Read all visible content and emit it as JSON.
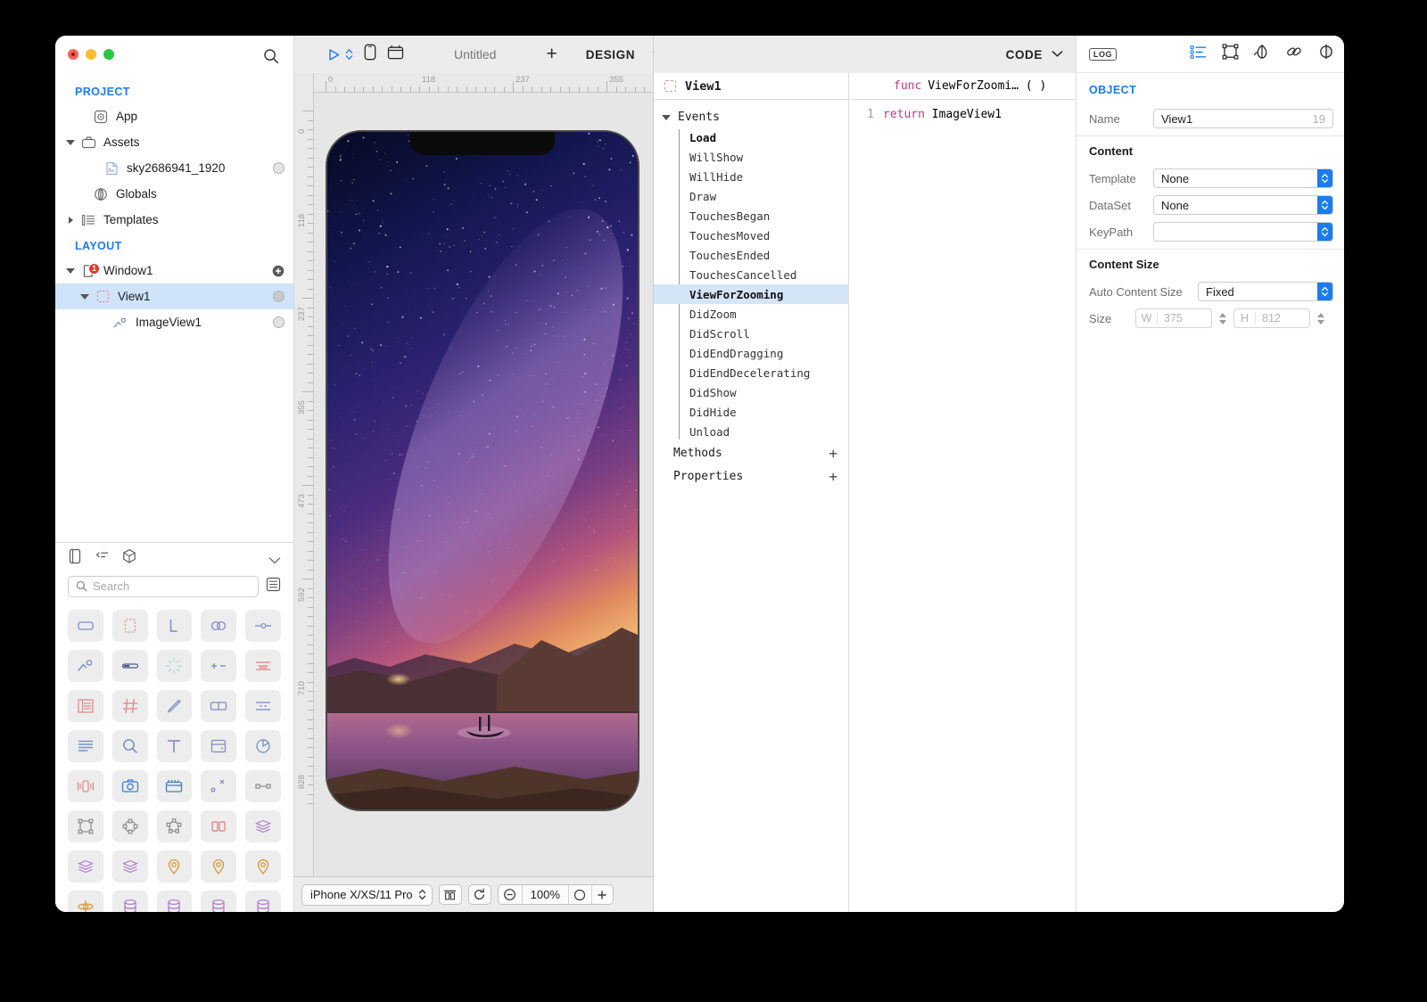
{
  "window": {
    "traffic_lights": [
      "close",
      "minimize",
      "zoom"
    ],
    "search_icon": "search-icon"
  },
  "sidebar": {
    "sections": [
      {
        "label": "PROJECT",
        "items": [
          {
            "label": "App",
            "icon": "app-icon",
            "indent": 1,
            "twisty": "none",
            "dot": false
          },
          {
            "label": "Assets",
            "icon": "assets-briefcase-icon",
            "indent": 1,
            "twisty": "open",
            "dot": false
          },
          {
            "label": "sky2686941_1920",
            "icon": "image-file-icon",
            "indent": 2,
            "twisty": "none",
            "dot": true
          },
          {
            "label": "Globals",
            "icon": "globals-icon",
            "indent": 1,
            "twisty": "none",
            "dot": false
          },
          {
            "label": "Templates",
            "icon": "templates-icon",
            "indent": 1,
            "twisty": "closed",
            "dot": false
          }
        ]
      },
      {
        "label": "LAYOUT",
        "items": [
          {
            "label": "Window1",
            "icon": "window-icon",
            "indent": 1,
            "twisty": "open",
            "dot": false,
            "plus": true,
            "badge": "1"
          },
          {
            "label": "View1",
            "icon": "view-dashed-icon",
            "indent": 2,
            "twisty": "open",
            "dot": true,
            "selected": true
          },
          {
            "label": "ImageView1",
            "icon": "imageview-icon",
            "indent": 3,
            "twisty": "none",
            "dot": true
          }
        ]
      }
    ],
    "palette": {
      "tabs": [
        "library-panel-icon",
        "inspector-list-icon",
        "objects-3d-icon"
      ],
      "collapse_icon": "chevron-down-icon",
      "search_placeholder": "Search",
      "list_mode_icon": "list-view-icon",
      "items": [
        {
          "name": "rounded-rect-icon",
          "color": "#7b8fc7"
        },
        {
          "name": "dashed-box-icon",
          "color": "#e08c8c"
        },
        {
          "name": "layout-L-icon",
          "color": "#7b8fc7"
        },
        {
          "name": "toggle-icon",
          "color": "#7b8fc7"
        },
        {
          "name": "slider-icon",
          "color": "#7b8fc7"
        },
        {
          "name": "imageview-icon",
          "color": "#7b8fc7"
        },
        {
          "name": "progress-bar-icon",
          "color": "#4a5a86"
        },
        {
          "name": "spinner-icon",
          "color": "#c9d0e3"
        },
        {
          "name": "stepper-icon",
          "color": "#7b8fc7"
        },
        {
          "name": "text-align-icon",
          "color": "#e08c8c"
        },
        {
          "name": "list-rows-icon",
          "color": "#e08c8c"
        },
        {
          "name": "grid-icon",
          "color": "#e08c8c"
        },
        {
          "name": "pen-icon",
          "color": "#7b8fc7"
        },
        {
          "name": "segmented-control-icon",
          "color": "#7b8fc7"
        },
        {
          "name": "keyboard-icon",
          "color": "#7b8fc7"
        },
        {
          "name": "text-lines-icon",
          "color": "#7b8fc7"
        },
        {
          "name": "search-icon",
          "color": "#7b8fc7"
        },
        {
          "name": "text-T-icon",
          "color": "#7b8fc7"
        },
        {
          "name": "card-icon",
          "color": "#7b8fc7"
        },
        {
          "name": "pie-chart-icon",
          "color": "#7b8fc7"
        },
        {
          "name": "vibrate-icon",
          "color": "#e08c8c"
        },
        {
          "name": "camera-icon",
          "color": "#3f7fd0"
        },
        {
          "name": "video-icon",
          "color": "#3f7fd0"
        },
        {
          "name": "motion-path-icon",
          "color": "#7b8fc7"
        },
        {
          "name": "link-nodes-icon",
          "color": "#8a8a8a"
        },
        {
          "name": "bounding-box-icon",
          "color": "#8a8a8a"
        },
        {
          "name": "circle-anchor-icon",
          "color": "#8a8a8a"
        },
        {
          "name": "polygon-anchor-icon",
          "color": "#8a8a8a"
        },
        {
          "name": "split-panes-icon",
          "color": "#e08c8c"
        },
        {
          "name": "layers-icon",
          "color": "#b07ccc"
        },
        {
          "name": "layers-icon",
          "color": "#b07ccc"
        },
        {
          "name": "layers-icon",
          "color": "#b07ccc"
        },
        {
          "name": "map-pin-icon",
          "color": "#d79a34"
        },
        {
          "name": "map-pin-icon",
          "color": "#d79a34"
        },
        {
          "name": "map-pin-icon",
          "color": "#d79a34"
        },
        {
          "name": "orbit-icon",
          "color": "#d79a34"
        },
        {
          "name": "database-icon",
          "color": "#b07ccc"
        },
        {
          "name": "database-icon",
          "color": "#b07ccc"
        },
        {
          "name": "database-icon",
          "color": "#b07ccc"
        },
        {
          "name": "database-icon",
          "color": "#b07ccc"
        }
      ]
    }
  },
  "design": {
    "toolbar": {
      "run_icon": "run-play-icon",
      "run_chevron_icon": "stepper-chevron-icon",
      "device_icon": "device-phone-icon",
      "window_icon": "window-frame-icon",
      "title": "Untitled",
      "add_label": "+",
      "mode": "DESIGN",
      "mode_chevron_icon": "chevron-down-icon"
    },
    "ruler_h": [
      "0",
      "118",
      "237",
      "355"
    ],
    "ruler_v": [
      "0",
      "118",
      "237",
      "355",
      "473",
      "592",
      "710",
      "828"
    ],
    "bottom": {
      "device": "iPhone X/XS/11 Pro",
      "device_stepper_icon": "stepper-chevron-icon",
      "split_icon": "split-view-icon",
      "rotate_icon": "rotate-device-icon",
      "zoom_out_icon": "zoom-out-icon",
      "zoom_level": "100%",
      "zoom_fit_icon": "zoom-fit-icon",
      "zoom_in_icon": "zoom-in-icon"
    }
  },
  "editor": {
    "top": {
      "mode": "CODE",
      "mode_chevron_icon": "chevron-down-icon"
    },
    "object_header": "View1",
    "object_icon": "view-dashed-icon",
    "groups": [
      {
        "label": "Events",
        "twisty": "open",
        "items": [
          "Load",
          "WillShow",
          "WillHide",
          "Draw",
          "TouchesBegan",
          "TouchesMoved",
          "TouchesEnded",
          "TouchesCancelled",
          "ViewForZooming",
          "DidZoom",
          "DidScroll",
          "DidEndDragging",
          "DidEndDecelerating",
          "DidShow",
          "DidHide",
          "Unload"
        ],
        "bold": [
          "Load"
        ],
        "selected": "ViewForZooming"
      }
    ],
    "footers": [
      {
        "label": "Methods",
        "add": "+"
      },
      {
        "label": "Properties",
        "add": "+"
      }
    ],
    "code": {
      "signature_keyword": "func",
      "signature_name": "ViewForZoomi… (  )",
      "lines": [
        {
          "number": "1",
          "keyword": "return",
          "rest": " ImageView1"
        }
      ]
    }
  },
  "inspector": {
    "log_label": "LOG",
    "tabs": [
      "inspector-list-icon",
      "geometry-box-icon",
      "appearance-icon",
      "bindings-link-icon",
      "visibility-icon"
    ],
    "section_header": "OBJECT",
    "name_label": "Name",
    "name_value": "View1",
    "name_number": "19",
    "content": {
      "header": "Content",
      "rows": [
        {
          "label": "Template",
          "value": "None",
          "type": "popup"
        },
        {
          "label": "DataSet",
          "value": "None",
          "type": "popup"
        },
        {
          "label": "KeyPath",
          "value": "",
          "type": "popup"
        }
      ]
    },
    "content_size": {
      "header": "Content Size",
      "auto_label": "Auto Content Size",
      "auto_value": "Fixed",
      "size_label": "Size",
      "width_prefix": "W",
      "width_value": "375",
      "height_prefix": "H",
      "height_value": "812"
    }
  },
  "colors": {
    "accent": "#1a7cf0",
    "selection": "#cfe4fa",
    "event_selection": "#d4e5f7",
    "keyword": "#c5358e",
    "badge": "#e8332a"
  }
}
